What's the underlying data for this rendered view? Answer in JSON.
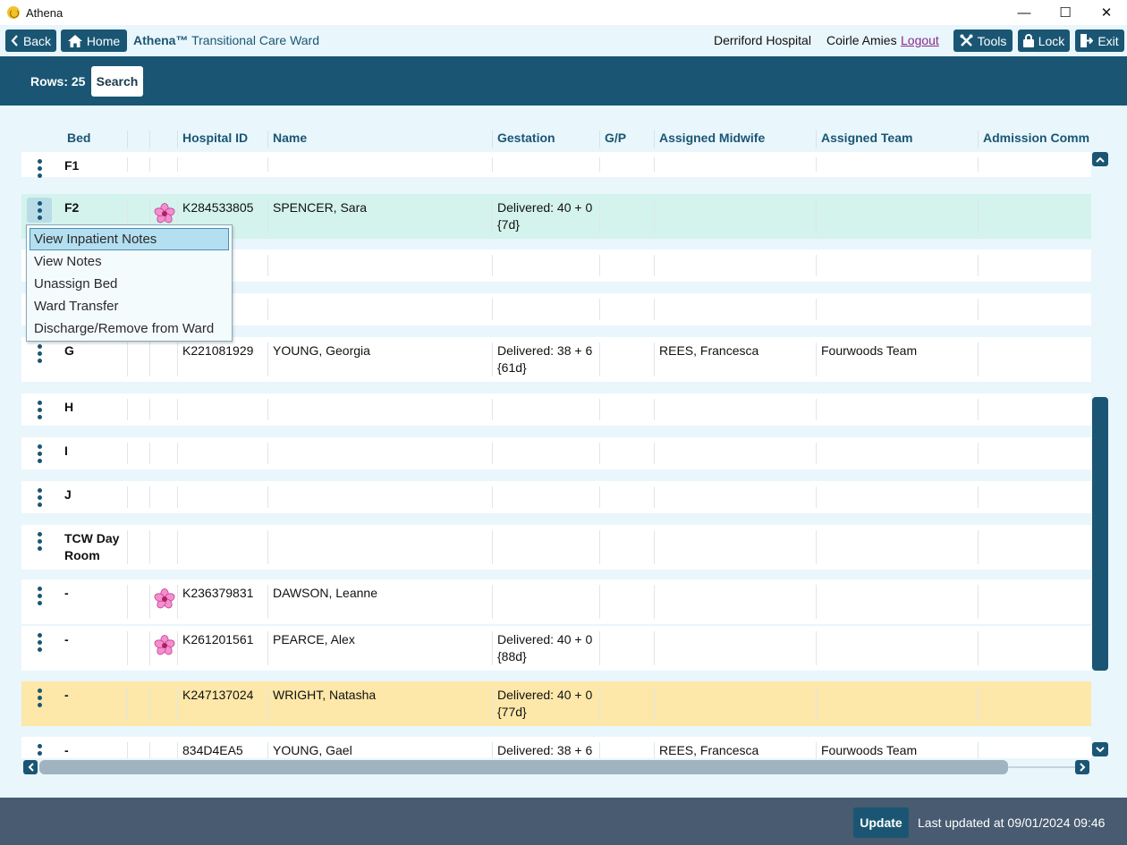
{
  "window": {
    "title": "Athena",
    "minimize": "—",
    "maximize": "☐",
    "close": "✕"
  },
  "toolbar": {
    "back_label": "Back",
    "home_label": "Home",
    "app_name": "Athena™",
    "ward_name": "Transitional Care Ward",
    "hospital": "Derriford Hospital",
    "user": "Coirle Amies",
    "logout_label": "Logout",
    "tools_label": "Tools",
    "lock_label": "Lock",
    "exit_label": "Exit"
  },
  "search": {
    "rows_label": "Rows: 25",
    "search_label": "Search"
  },
  "columns": [
    "Bed",
    "",
    "",
    "Hospital ID",
    "Name",
    "Gestation",
    "G/P",
    "Assigned Midwife",
    "Assigned Team",
    "Admission Comm"
  ],
  "rows": [
    {
      "bed": "F1",
      "flower": false,
      "hospital_id": "",
      "name": "",
      "gestation": "",
      "gp": "",
      "midwife": "",
      "team": "",
      "state": "normal"
    },
    {
      "bed": "F2",
      "flower": true,
      "hospital_id": "K284533805",
      "name": "SPENCER, Sara",
      "gestation": "Delivered: 40 + 0\n{7d}",
      "gp": "",
      "midwife": "",
      "team": "",
      "state": "selected"
    },
    {
      "bed": "",
      "flower": false,
      "hospital_id": "",
      "name": "",
      "gestation": "",
      "gp": "",
      "midwife": "",
      "team": "",
      "state": "normal"
    },
    {
      "bed": "",
      "flower": false,
      "hospital_id": "",
      "name": "",
      "gestation": "",
      "gp": "",
      "midwife": "",
      "team": "",
      "state": "normal"
    },
    {
      "bed": "G",
      "flower": false,
      "hospital_id": "K221081929",
      "name": "YOUNG, Georgia",
      "gestation": "Delivered: 38 + 6\n{61d}",
      "gp": "",
      "midwife": "REES, Francesca",
      "team": "Fourwoods Team",
      "state": "normal"
    },
    {
      "bed": "H",
      "flower": false,
      "hospital_id": "",
      "name": "",
      "gestation": "",
      "gp": "",
      "midwife": "",
      "team": "",
      "state": "normal"
    },
    {
      "bed": "I",
      "flower": false,
      "hospital_id": "",
      "name": "",
      "gestation": "",
      "gp": "",
      "midwife": "",
      "team": "",
      "state": "normal"
    },
    {
      "bed": "J",
      "flower": false,
      "hospital_id": "",
      "name": "",
      "gestation": "",
      "gp": "",
      "midwife": "",
      "team": "",
      "state": "normal"
    },
    {
      "bed": "TCW Day Room",
      "flower": false,
      "hospital_id": "",
      "name": "",
      "gestation": "",
      "gp": "",
      "midwife": "",
      "team": "",
      "state": "normal"
    },
    {
      "bed": "-",
      "flower": true,
      "hospital_id": "K236379831",
      "name": "DAWSON, Leanne",
      "gestation": "",
      "gp": "",
      "midwife": "",
      "team": "",
      "state": "normal"
    },
    {
      "bed": "-",
      "flower": true,
      "hospital_id": "K261201561",
      "name": "PEARCE, Alex",
      "gestation": "Delivered: 40 + 0\n{88d}",
      "gp": "",
      "midwife": "",
      "team": "",
      "state": "normal"
    },
    {
      "bed": "-",
      "flower": false,
      "hospital_id": "K247137024",
      "name": "WRIGHT, Natasha",
      "gestation": "Delivered: 40 + 0\n{77d}",
      "gp": "",
      "midwife": "",
      "team": "",
      "state": "warning"
    },
    {
      "bed": "-",
      "flower": false,
      "hospital_id": "834D4EA5",
      "name": "YOUNG, Gael",
      "gestation": "Delivered: 38 + 6",
      "gp": "",
      "midwife": "REES, Francesca",
      "team": "Fourwoods Team",
      "state": "normal"
    }
  ],
  "context_menu": [
    "View Inpatient Notes",
    "View Notes",
    "Unassign Bed",
    "Ward Transfer",
    "Discharge/Remove from Ward"
  ],
  "footer": {
    "update_label": "Update",
    "last_updated": "Last updated at 09/01/2024 09:46"
  },
  "colors": {
    "primary": "#1a5673",
    "background": "#e9f6fc",
    "selected_row": "#d3f3ec",
    "warning_row": "#fde8a9",
    "footer": "#485b70",
    "logout_link": "#8a2a8a"
  }
}
